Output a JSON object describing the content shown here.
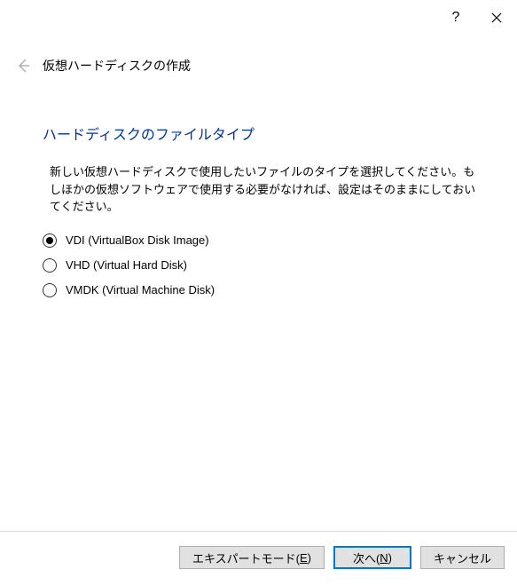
{
  "titlebar": {
    "help_tooltip": "?",
    "close_tooltip": "×"
  },
  "header": {
    "wizard_title": "仮想ハードディスクの作成"
  },
  "section": {
    "heading": "ハードディスクのファイルタイプ",
    "description": "新しい仮想ハードディスクで使用したいファイルのタイプを選択してください。もしほかの仮想ソフトウェアで使用する必要がなければ、設定はそのままにしておいてください。"
  },
  "options": [
    {
      "label": "VDI (VirtualBox Disk Image)",
      "selected": true
    },
    {
      "label": "VHD (Virtual Hard Disk)",
      "selected": false
    },
    {
      "label": "VMDK (Virtual Machine Disk)",
      "selected": false
    }
  ],
  "buttons": {
    "expert_pre": "エキスパートモード(",
    "expert_mn": "E",
    "expert_post": ")",
    "next_pre": "次へ(",
    "next_mn": "N",
    "next_post": ")",
    "cancel": "キャンセル"
  }
}
